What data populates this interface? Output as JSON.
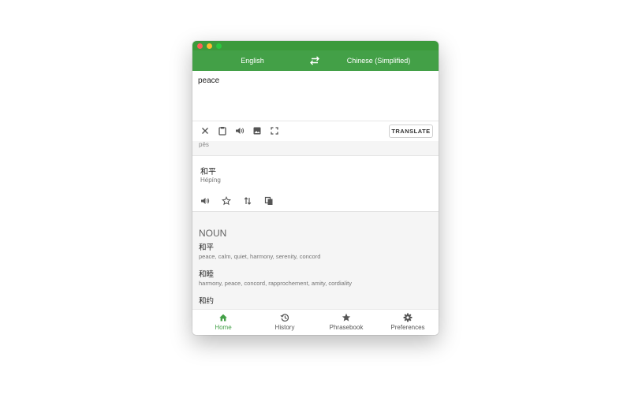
{
  "colors": {
    "accent": "#43a047",
    "titlebar": "#3c9a3c",
    "text_muted": "#757575"
  },
  "window_controls": [
    "close",
    "minimize",
    "maximize"
  ],
  "header": {
    "source_language": "English",
    "target_language": "Chinese (Simplified)",
    "swap_icon": "swap-arrows-icon"
  },
  "input": {
    "value": "peace"
  },
  "input_toolbar": {
    "icons": [
      "close-icon",
      "clipboard-icon",
      "speaker-icon",
      "image-icon",
      "fullscreen-icon"
    ],
    "translate_label": "TRANSLATE"
  },
  "result": {
    "source_transliteration": "pēs",
    "translation": "和平",
    "translation_romanization": "Hépíng",
    "actions": [
      "speaker-icon",
      "star-icon",
      "swap-vertical-icon",
      "copy-icon"
    ]
  },
  "dictionary": {
    "part_of_speech": "NOUN",
    "entries": [
      {
        "word": "和平",
        "synonyms": "peace, calm, quiet, harmony, serenity, concord"
      },
      {
        "word": "和睦",
        "synonyms": "harmony, peace, concord, rapprochement, amity, cordiality"
      },
      {
        "word": "和约",
        "synonyms": ""
      }
    ]
  },
  "bottom_nav": [
    {
      "label": "Home",
      "icon": "home-icon",
      "active": true
    },
    {
      "label": "History",
      "icon": "history-icon",
      "active": false
    },
    {
      "label": "Phrasebook",
      "icon": "star-icon",
      "active": false
    },
    {
      "label": "Preferences",
      "icon": "gear-icon",
      "active": false
    }
  ]
}
